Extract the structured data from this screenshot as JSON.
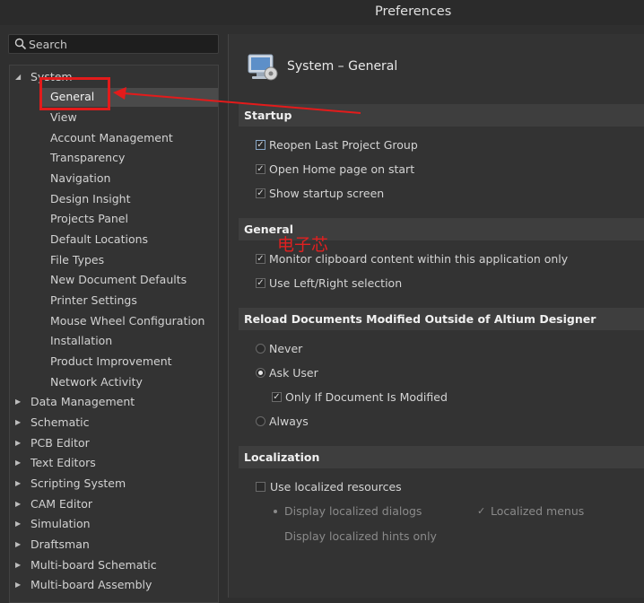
{
  "window": {
    "title": "Preferences"
  },
  "search": {
    "placeholder": "Search"
  },
  "tree": {
    "root": "System",
    "children": [
      "General",
      "View",
      "Account Management",
      "Transparency",
      "Navigation",
      "Design Insight",
      "Projects Panel",
      "Default Locations",
      "File Types",
      "New Document Defaults",
      "Printer Settings",
      "Mouse Wheel Configuration",
      "Installation",
      "Product Improvement",
      "Network Activity"
    ],
    "selected": "General",
    "siblings": [
      "Data Management",
      "Schematic",
      "PCB Editor",
      "Text Editors",
      "Scripting System",
      "CAM Editor",
      "Simulation",
      "Draftsman",
      "Multi-board Schematic",
      "Multi-board Assembly"
    ]
  },
  "page": {
    "title": "System – General",
    "icon": "system-general-icon"
  },
  "startup": {
    "header": "Startup",
    "reopen_last_project_group": {
      "label": "Reopen Last Project Group",
      "checked": true
    },
    "open_home_page": {
      "label": "Open Home page on start",
      "checked": true
    },
    "show_startup_screen": {
      "label": "Show startup screen",
      "checked": true
    }
  },
  "general": {
    "header": "General",
    "monitor_clipboard": {
      "label": "Monitor clipboard content within this application only",
      "checked": true
    },
    "left_right_selection": {
      "label": "Use Left/Right selection",
      "checked": true
    }
  },
  "reload": {
    "header": "Reload Documents Modified Outside of Altium Designer",
    "never": "Never",
    "ask_user": "Ask User",
    "only_if_modified": {
      "label": "Only If Document Is Modified",
      "checked": true
    },
    "always": "Always",
    "selected": "Ask User"
  },
  "localization": {
    "header": "Localization",
    "use_localized": {
      "label": "Use localized resources",
      "checked": false
    },
    "display_dialogs": "Display localized dialogs",
    "localized_menus": "Localized menus",
    "display_hints": "Display localized hints only"
  },
  "watermark": {
    "text": "电子芯"
  },
  "colors": {
    "annotation": "#e31b1b",
    "background": "#2f2f2f"
  }
}
